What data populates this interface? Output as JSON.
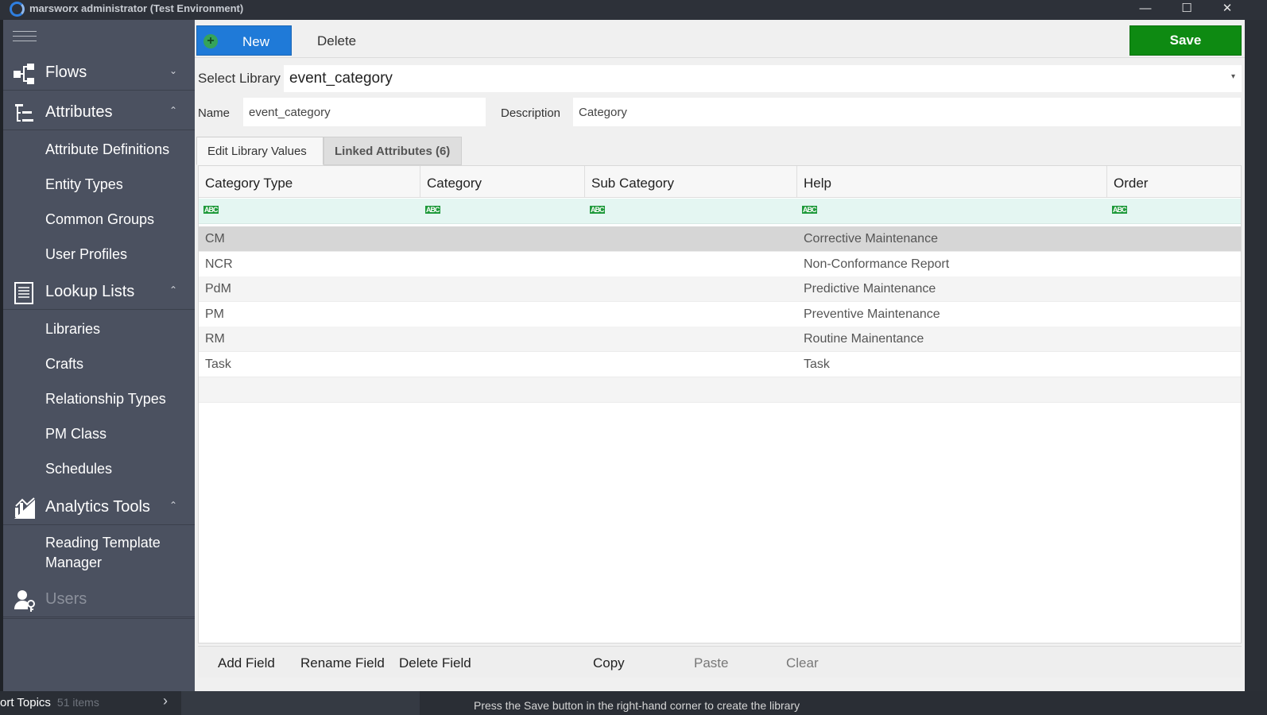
{
  "window": {
    "title": "marsworx administrator (Test Environment)",
    "minimize": "—",
    "maximize": "☐",
    "close": "✕"
  },
  "sidebar": {
    "flows": {
      "label": "Flows",
      "chevron": "⌄"
    },
    "attributes": {
      "label": "Attributes",
      "chevron": "⌃",
      "items": [
        "Attribute Definitions",
        "Entity Types",
        "Common Groups",
        "User Profiles"
      ]
    },
    "lookup_lists": {
      "label": "Lookup Lists",
      "chevron": "⌃",
      "items": [
        "Libraries",
        "Crafts",
        "Relationship Types",
        "PM Class",
        "Schedules"
      ]
    },
    "analytics_tools": {
      "label": "Analytics Tools",
      "chevron": "⌃",
      "items": [
        "Reading Template Manager"
      ]
    },
    "users": {
      "label": "Users"
    }
  },
  "toolbar": {
    "new_label": "New",
    "delete_label": "Delete",
    "save_label": "Save"
  },
  "form": {
    "select_library_label": "Select Library",
    "select_library_value": "event_category",
    "name_label": "Name",
    "name_value": "event_category",
    "description_label": "Description",
    "description_value": "Category"
  },
  "tabs": [
    "Edit Library Values",
    "Linked Attributes (6)"
  ],
  "grid": {
    "columns": [
      "Category Type",
      "Category",
      "Sub Category",
      "Help",
      "Order"
    ],
    "filter_icon": "ABC",
    "rows": [
      [
        "CM",
        "",
        "",
        "Corrective Maintenance",
        ""
      ],
      [
        "NCR",
        "",
        "",
        "Non-Conformance Report",
        ""
      ],
      [
        "PdM",
        "",
        "",
        "Predictive Maintenance",
        ""
      ],
      [
        "PM",
        "",
        "",
        "Preventive Maintenance",
        ""
      ],
      [
        "RM",
        "",
        "",
        "Routine Mainentance",
        ""
      ],
      [
        "Task",
        "",
        "",
        "Task",
        ""
      ]
    ]
  },
  "bottom_actions": {
    "add_field": "Add Field",
    "rename_field": "Rename Field",
    "delete_field": "Delete Field",
    "copy": "Copy",
    "paste": "Paste",
    "clear": "Clear"
  },
  "footer": {
    "topics": "ort Topics",
    "count": "51 items",
    "arrow": "›",
    "hint": "Press the Save button in the right-hand corner to create the library"
  },
  "colors": {
    "sidebar_bg": "#4b5160",
    "new_button": "#1f7ad8",
    "save_button": "#0e8a12",
    "filter_row": "#e4f6f2",
    "selected_row": "#d6d6d6"
  }
}
